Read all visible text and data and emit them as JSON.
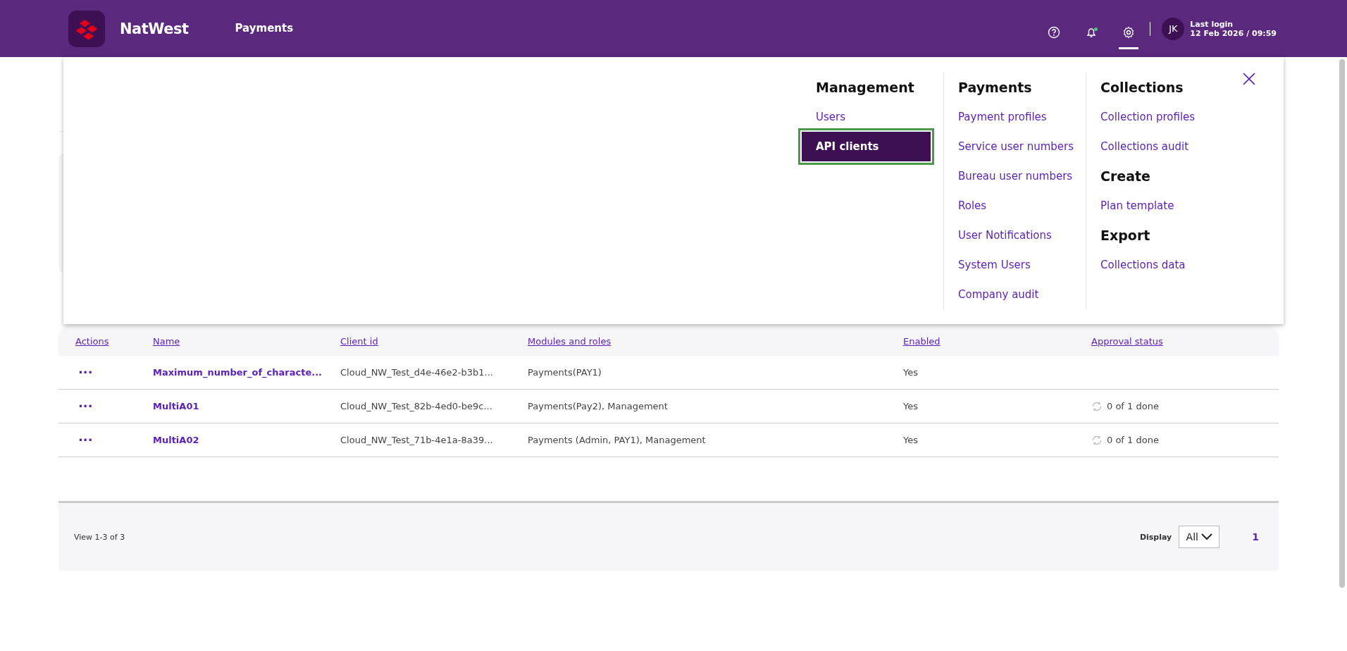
{
  "header": {
    "brand": "NatWest",
    "nav": [
      {
        "label": "Payments",
        "selected": false
      }
    ],
    "tools": [
      {
        "kind": "help",
        "selected": false,
        "notification": false
      },
      {
        "kind": "bell",
        "selected": false,
        "notification": true
      },
      {
        "kind": "settings",
        "selected": true,
        "notification": false
      }
    ],
    "avatar": "JK",
    "last_login_label": "Last login",
    "last_login_value": "12 Feb 2026 / 09:59"
  },
  "menu": {
    "columns": [
      {
        "sections": [
          {
            "heading": "Management",
            "items": [
              {
                "label": "Users",
                "selected": false
              },
              {
                "label": "API clients",
                "selected": true
              }
            ]
          }
        ]
      },
      {
        "sections": [
          {
            "heading": "Payments",
            "items": [
              {
                "label": "Payment profiles",
                "selected": false
              },
              {
                "label": "Service user numbers",
                "selected": false
              },
              {
                "label": "Bureau user numbers",
                "selected": false
              },
              {
                "label": "Roles",
                "selected": false
              },
              {
                "label": "User Notifications",
                "selected": false
              },
              {
                "label": "System Users",
                "selected": false
              },
              {
                "label": "Company audit",
                "selected": false
              }
            ]
          }
        ]
      },
      {
        "sections": [
          {
            "heading": "Collections",
            "items": [
              {
                "label": "Collection profiles",
                "selected": false
              },
              {
                "label": "Collections audit",
                "selected": false
              }
            ]
          },
          {
            "heading": "Create",
            "items": [
              {
                "label": "Plan template",
                "selected": false
              }
            ]
          },
          {
            "heading": "Export",
            "items": [
              {
                "label": "Collections data",
                "selected": false
              }
            ]
          }
        ]
      }
    ]
  },
  "table": {
    "columns": [
      "Actions",
      "Name",
      "Client id",
      "Modules and roles",
      "Enabled",
      "Approval status"
    ],
    "rows": [
      {
        "actions": "···",
        "name": "Maximum_number_of_characte...",
        "client_id": "Cloud_NW_Test_d4e-46e2-b3b1...",
        "modules": "Payments(PAY1)",
        "enabled": "Yes"
      },
      {
        "actions": "···",
        "name": "MultiA01",
        "client_id": "Cloud_NW_Test_82b-4ed0-be9c...",
        "modules": "Payments(Pay2), Management",
        "enabled": "Yes",
        "approval": "0 of 1 done"
      },
      {
        "actions": "···",
        "name": "MultiA02",
        "client_id": "Cloud_NW_Test_71b-4e1a-8a39...",
        "modules": "Payments (Admin, PAY1), Management",
        "enabled": "Yes",
        "approval": "0 of 1 done"
      }
    ]
  },
  "footer": {
    "summary": "View 1-3 of 3",
    "display_label": "Display",
    "display_value": "All",
    "pages": [
      {
        "label": "1",
        "selected": true
      }
    ]
  }
}
